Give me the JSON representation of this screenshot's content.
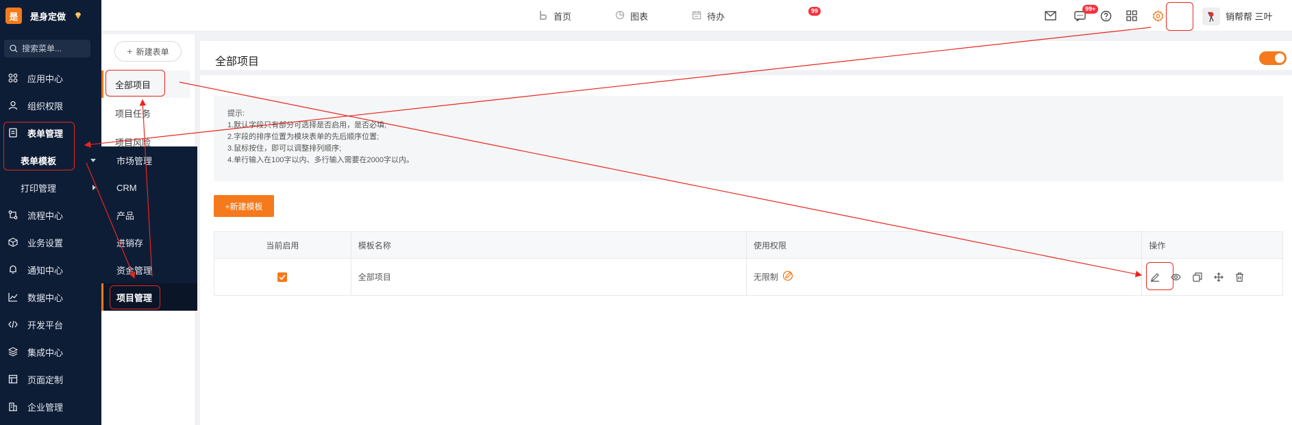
{
  "app": {
    "logo_char": "是",
    "name": "是身定做"
  },
  "search": {
    "placeholder": "搜索菜单..."
  },
  "sidebar": {
    "items": [
      {
        "label": "应用中心",
        "icon": "grid-icon"
      },
      {
        "label": "组织权限",
        "icon": "user-icon"
      },
      {
        "label": "表单管理",
        "icon": "form-icon"
      },
      {
        "label": "表单模板",
        "icon": ""
      },
      {
        "label": "打印管理",
        "icon": ""
      },
      {
        "label": "流程中心",
        "icon": "flow-icon"
      },
      {
        "label": "业务设置",
        "icon": "cube-icon"
      },
      {
        "label": "通知中心",
        "icon": "bell-icon"
      },
      {
        "label": "数据中心",
        "icon": "chart-icon"
      },
      {
        "label": "开发平台",
        "icon": "code-icon"
      },
      {
        "label": "集成中心",
        "icon": "layers-icon"
      },
      {
        "label": "页面定制",
        "icon": "page-icon"
      },
      {
        "label": "企业管理",
        "icon": "building-icon"
      }
    ]
  },
  "flyout": {
    "items": [
      "市场管理",
      "CRM",
      "产品",
      "进销存",
      "资金管理",
      "项目管理"
    ]
  },
  "col2": {
    "new_form": "新建表单",
    "items": [
      "全部项目",
      "项目任务",
      "项目风险"
    ]
  },
  "topbar": {
    "nav": [
      {
        "label": "首页",
        "icon": "home-icon"
      },
      {
        "label": "图表",
        "icon": "pie-icon"
      },
      {
        "label": "待办",
        "icon": "calendar-icon",
        "badge": "99"
      }
    ],
    "msg_badge": "99+",
    "username": "销帮帮 三叶"
  },
  "main": {
    "title": "全部项目",
    "tips": [
      "提示:",
      "1.默认字段只有部分可选择是否启用，是否必填;",
      "2.字段的排序位置为模块表单的先后顺序位置;",
      "3.鼠标按住，即可以调整排列顺序;",
      "4.单行输入在100字以内、多行输入需要在2000字以内。"
    ],
    "new_template": "+新建模板",
    "table": {
      "headers": [
        "当前启用",
        "模板名称",
        "使用权限",
        "操作"
      ],
      "rows": [
        {
          "enabled": true,
          "name": "全部项目",
          "permission": "无限制"
        }
      ]
    }
  },
  "colors": {
    "accent": "#f47a1b",
    "sidebar_bg": "#0e1d36",
    "annotation": "#e8261d"
  }
}
